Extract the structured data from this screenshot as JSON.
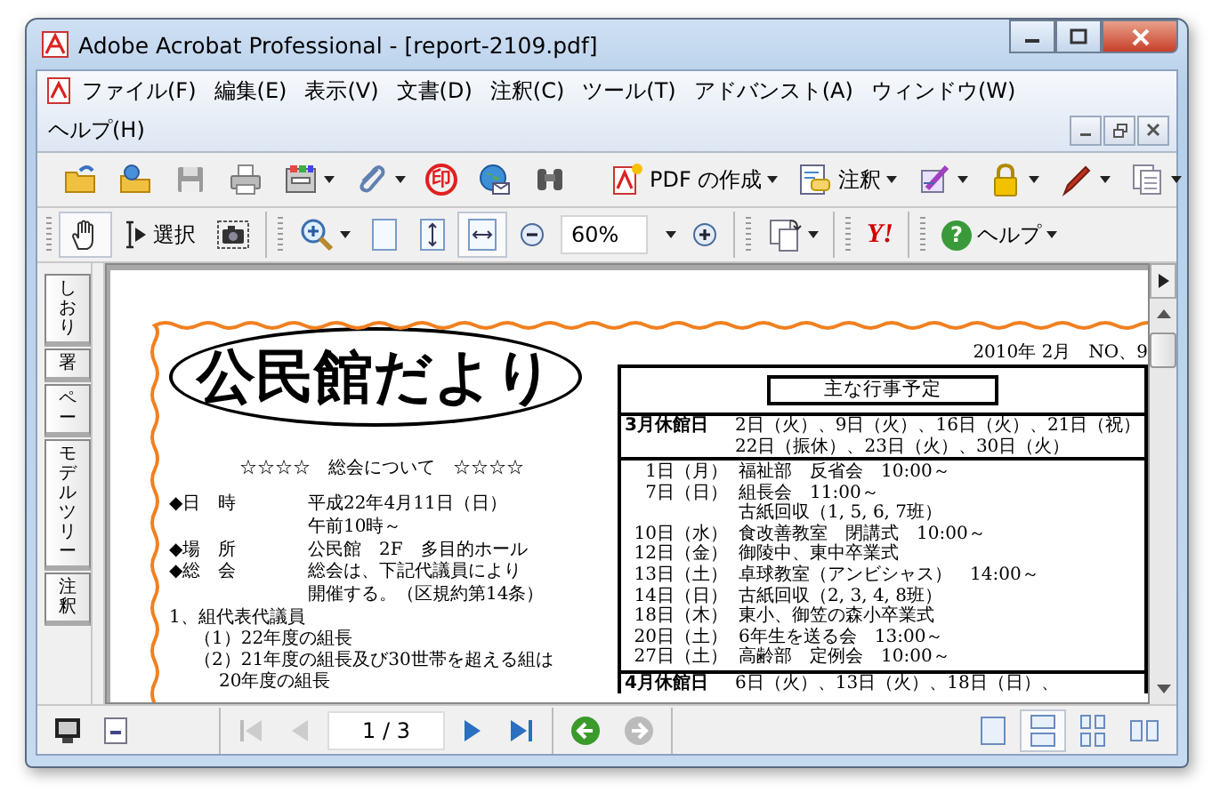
{
  "window": {
    "title": "Adobe Acrobat Professional - [report-2109.pdf]"
  },
  "menu": [
    "ファイル(F)",
    "編集(E)",
    "表示(V)",
    "文書(D)",
    "注釈(C)",
    "ツール(T)",
    "アドバンスト(A)",
    "ウィンドウ(W)",
    "ヘルプ(H)"
  ],
  "toolbar_1": {
    "stamp_glyph": "印",
    "create_pdf_label": "PDF の作成",
    "comment_label": "注釈"
  },
  "toolbar_2": {
    "hand_tool": {
      "selected": true
    },
    "select_label": "選択",
    "fit_width": {
      "selected": true
    },
    "zoom_value": "60%",
    "yahoo_label": "Y!",
    "help_glyph": "?",
    "help_label": "ヘルプ"
  },
  "side_tabs": [
    {
      "label": "しおり"
    },
    {
      "label": "署"
    },
    {
      "label": "ペー"
    },
    {
      "label": "モデルツリー"
    },
    {
      "label": "注釈"
    }
  ],
  "document": {
    "title": "公民館だより",
    "issue": "2010年 2月　NO、9",
    "subtitle": "☆☆☆☆　総会について　☆☆☆☆",
    "details": [
      {
        "label": "◆日　時",
        "lines": [
          "平成22年4月11日（日）",
          "午前10時～"
        ]
      },
      {
        "label": "◆場　所",
        "lines": [
          "公民館　2F　多目的ホール"
        ]
      },
      {
        "label": "◆総　会",
        "lines": [
          "総会は、下記代議員により",
          "開催する。（区規約第14条）"
        ]
      }
    ],
    "items": [
      {
        "text": "1、組代表代議員",
        "children": [
          {
            "text": "（1）22年度の組長"
          },
          {
            "text": "（2）21年度の組長及び30世帯を超える組は"
          },
          {
            "text": "20年度の組長"
          }
        ]
      }
    ],
    "schedule": {
      "heading": "主な行事予定",
      "closures": [
        {
          "label": "3月休館日",
          "lines": [
            "2日（火）、9日（火）、16日（火）、21日（祝）",
            "22日（振休）、23日（火）、30日（火）"
          ]
        }
      ],
      "events": [
        {
          "date": "1日（月）",
          "text": "福祉部　反省会　10:00～"
        },
        {
          "date": "7日（日）",
          "text": "組長会　11:00～"
        },
        {
          "text": "古紙回収（1, 5, 6, 7班）"
        },
        {
          "date": "10日（水）",
          "text": "食改善教室　閉講式　10:00～"
        },
        {
          "date": "12日（金）",
          "text": "御陵中、東中卒業式"
        },
        {
          "date": "13日（土）",
          "text": "卓球教室（アンビシャス）　14:00～"
        },
        {
          "date": "14日（日）",
          "text": "古紙回収（2, 3, 4, 8班）"
        },
        {
          "date": "18日（木）",
          "text": "東小、御笠の森小卒業式"
        },
        {
          "date": "20日（土）",
          "text": "6年生を送る会　13:00～"
        },
        {
          "date": "27日（土）",
          "text": "高齢部　定例会　10:00～"
        }
      ],
      "closures_after": [
        {
          "label": "4月休館日",
          "lines": [
            "6日（火）、13日（火）、18日（日）、"
          ]
        }
      ]
    }
  },
  "navigation": {
    "first": {
      "disabled": true
    },
    "previous": {
      "disabled": true
    },
    "page": "1 / 3",
    "next": {
      "disabled": false
    },
    "last": {
      "disabled": false
    },
    "back": {
      "disabled": false
    },
    "forward": {
      "disabled": true
    }
  },
  "view_modes": [
    {
      "selected": false
    },
    {
      "selected": true
    },
    {
      "selected": false
    },
    {
      "selected": false
    }
  ]
}
